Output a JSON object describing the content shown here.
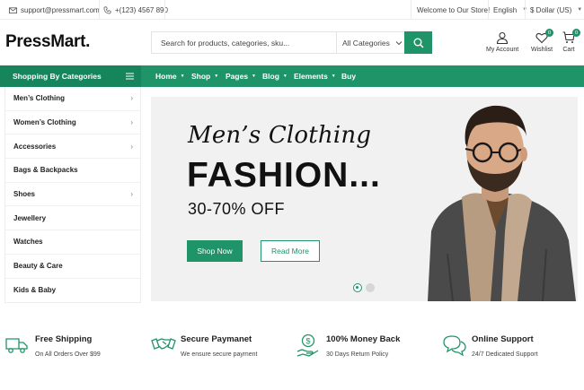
{
  "topbar": {
    "email": "support@pressmart.com",
    "phone": "+(123) 4567 890",
    "welcome": "Welcome to Our Store!",
    "language": "English",
    "currency": "$ Dollar (US)"
  },
  "header": {
    "logo": "PressMart.",
    "search_placeholder": "Search for products, categories, sku...",
    "search_category": "All Categories",
    "account_label": "My Account",
    "wishlist_label": "Wishlist",
    "wishlist_count": "0",
    "cart_label": "Cart",
    "cart_count": "0"
  },
  "nav": {
    "categories_title": "Shopping By Categories",
    "items": [
      "Home",
      "Shop",
      "Pages",
      "Blog",
      "Elements",
      "Buy"
    ]
  },
  "sidebar": {
    "items": [
      {
        "label": "Men’s Clothing",
        "has_submenu": true
      },
      {
        "label": "Women’s Clothing",
        "has_submenu": true
      },
      {
        "label": "Accessories",
        "has_submenu": true
      },
      {
        "label": "Bags & Backpacks",
        "has_submenu": false
      },
      {
        "label": "Shoes",
        "has_submenu": true
      },
      {
        "label": "Jewellery",
        "has_submenu": false
      },
      {
        "label": "Watches",
        "has_submenu": false
      },
      {
        "label": "Beauty & Care",
        "has_submenu": false
      },
      {
        "label": "Kids & Baby",
        "has_submenu": false
      }
    ]
  },
  "hero": {
    "script_title": "Men’s Clothing",
    "title": "FASHION...",
    "subtitle": "30-70% OFF",
    "shop_now": "Shop Now",
    "read_more": "Read More",
    "slide_count": 2,
    "active_slide": 1
  },
  "features": [
    {
      "icon": "truck-icon",
      "title": "Free Shipping",
      "subtitle": "On All Orders Over $99"
    },
    {
      "icon": "handshake-icon",
      "title": "Secure Paymanet",
      "subtitle": "We ensure secure payment"
    },
    {
      "icon": "money-hand-icon",
      "title": "100% Money Back",
      "subtitle": "30 Days Return Policy"
    },
    {
      "icon": "chat-icon",
      "title": "Online Support",
      "subtitle": "24/7 Dedicated Support"
    }
  ],
  "colors": {
    "brand_green": "#1f9468",
    "category_header_green": "#16855c",
    "hero_background": "#f1f1f1"
  }
}
